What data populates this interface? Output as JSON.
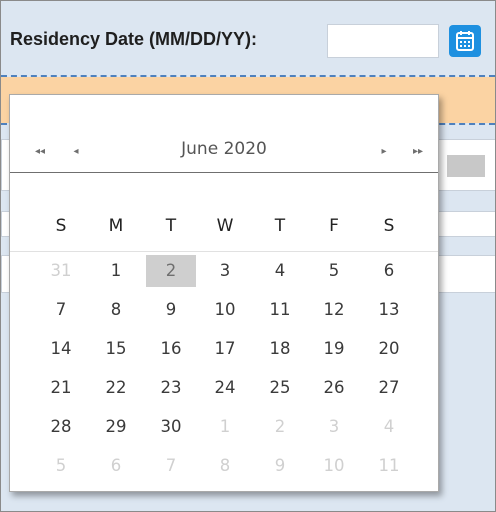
{
  "form": {
    "residency_label": "Residency Date (MM/DD/YY):",
    "residency_value": ""
  },
  "icons": {
    "calendar_button": "calendar-icon",
    "prev_year": "double-chevron-left-icon",
    "prev_month": "chevron-left-icon",
    "next_month": "chevron-right-icon",
    "next_year": "double-chevron-right-icon"
  },
  "picker": {
    "month_title": "June 2020",
    "nav_prev_year": "◂◂",
    "nav_prev_month": "◂",
    "nav_next_month": "▸",
    "nav_next_year": "▸▸",
    "weekdays": [
      "S",
      "M",
      "T",
      "W",
      "T",
      "F",
      "S"
    ],
    "weeks": [
      [
        "31",
        "1",
        "2",
        "3",
        "4",
        "5",
        "6"
      ],
      [
        "7",
        "8",
        "9",
        "10",
        "11",
        "12",
        "13"
      ],
      [
        "14",
        "15",
        "16",
        "17",
        "18",
        "19",
        "20"
      ],
      [
        "21",
        "22",
        "23",
        "24",
        "25",
        "26",
        "27"
      ],
      [
        "28",
        "29",
        "30",
        "1",
        "2",
        "3",
        "4"
      ],
      [
        "5",
        "6",
        "7",
        "8",
        "9",
        "10",
        "11"
      ]
    ],
    "other_month": [
      [
        true,
        false,
        false,
        false,
        false,
        false,
        false
      ],
      [
        false,
        false,
        false,
        false,
        false,
        false,
        false
      ],
      [
        false,
        false,
        false,
        false,
        false,
        false,
        false
      ],
      [
        false,
        false,
        false,
        false,
        false,
        false,
        false
      ],
      [
        false,
        false,
        false,
        true,
        true,
        true,
        true
      ],
      [
        true,
        true,
        true,
        true,
        true,
        true,
        true
      ]
    ],
    "selected": {
      "week": 0,
      "day": 2
    }
  },
  "colors": {
    "accent": "#1e90e0",
    "form_background": "#dce6f1",
    "highlight_band": "#fbd3a3",
    "selected_day": "#cfcfcf",
    "dashed_border": "#4f81bd"
  }
}
